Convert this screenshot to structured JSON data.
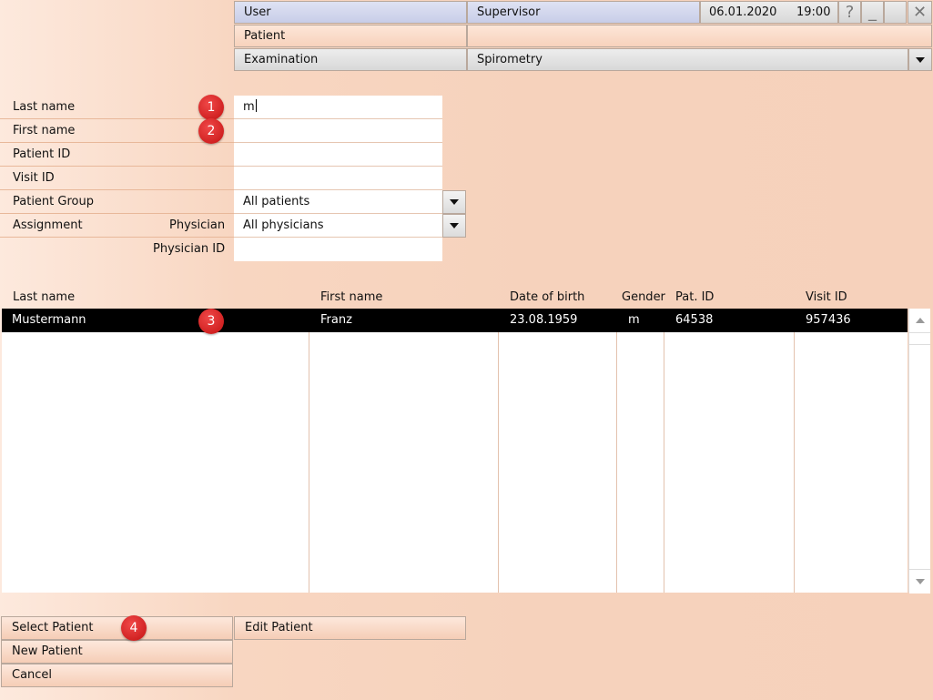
{
  "header": {
    "user_label": "User",
    "user_value": "Supervisor",
    "date": "06.01.2020",
    "time": "19:00",
    "help_glyph": "?",
    "minimize_glyph": "_",
    "close_glyph": "✕",
    "patient_label": "Patient",
    "patient_value": "",
    "examination_label": "Examination",
    "examination_value": "Spirometry"
  },
  "form": {
    "last_name_label": "Last name",
    "last_name_value": "m",
    "first_name_label": "First name",
    "first_name_value": "",
    "patient_id_label": "Patient ID",
    "patient_id_value": "",
    "visit_id_label": "Visit ID",
    "visit_id_value": "",
    "patient_group_label": "Patient Group",
    "patient_group_value": "All patients",
    "assignment_label": "Assignment",
    "physician_label": "Physician",
    "physician_value": "All physicians",
    "physician_id_label": "Physician ID",
    "physician_id_value": ""
  },
  "table": {
    "columns": [
      "Last name",
      "First name",
      "Date of birth",
      "Gender",
      "Pat. ID",
      "Visit ID"
    ],
    "rows": [
      [
        "Mustermann",
        "Franz",
        "23.08.1959",
        "m",
        "64538",
        "957436"
      ]
    ]
  },
  "badges": [
    "1",
    "2",
    "3",
    "4"
  ],
  "buttons": {
    "select_patient": "Select Patient",
    "edit_patient": "Edit Patient",
    "new_patient": "New Patient",
    "cancel": "Cancel"
  },
  "colors": {
    "background": "#f6d2bc",
    "selected_row": "#000000",
    "badge": "#d61c1c",
    "header_blue": "#c8cde8"
  },
  "icons": {
    "help": "help-icon",
    "minimize": "minimize-icon",
    "close": "close-icon",
    "dropdown": "chevron-down-icon",
    "scroll_up": "scroll-up-icon",
    "scroll_down": "scroll-down-icon"
  }
}
